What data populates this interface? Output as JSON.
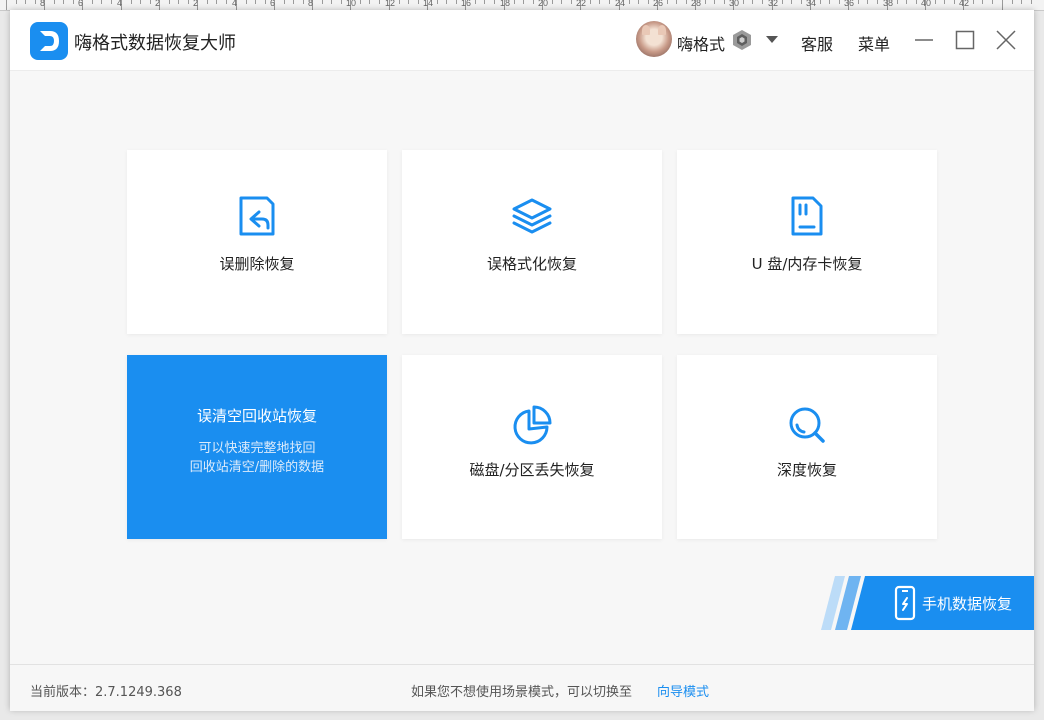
{
  "ruler": {
    "labels": [
      "8",
      "6",
      "4",
      "2",
      "2",
      "4",
      "6",
      "8",
      "10",
      "12",
      "14",
      "16",
      "18",
      "20",
      "22",
      "24",
      "26",
      "28",
      "30",
      "32",
      "34",
      "36",
      "38",
      "40",
      "42"
    ]
  },
  "app": {
    "title": "嗨格式数据恢复大师",
    "brand_color": "#1a8ef0"
  },
  "header": {
    "username": "嗨格式",
    "service_label": "客服",
    "menu_label": "菜单",
    "icons": {
      "avatar": "avatar-image",
      "vip": "vip-badge-icon",
      "dropdown": "caret-down-icon",
      "minimize": "minimize-icon",
      "maximize": "maximize-icon",
      "close": "close-icon"
    }
  },
  "cards": {
    "deleted": {
      "label": "误删除恢复",
      "icon": "file-restore-icon"
    },
    "formatted": {
      "label": "误格式化恢复",
      "icon": "layers-icon"
    },
    "usb": {
      "label": "U 盘/内存卡恢复",
      "icon": "sd-card-icon"
    },
    "recycle": {
      "label": "误清空回收站恢复",
      "desc_line1": "可以快速完整地找回",
      "desc_line2": "回收站清空/删除的数据"
    },
    "partition": {
      "label": "磁盘/分区丢失恢复",
      "icon": "pie-chart-icon"
    },
    "deep": {
      "label": "深度恢复",
      "icon": "search-icon"
    }
  },
  "mobile": {
    "label": "手机数据恢复",
    "icon": "phone-icon"
  },
  "footer": {
    "version": "当前版本：2.7.1249.368",
    "hint": "如果您不想使用场景模式，可以切换至",
    "guide_link": "向导模式",
    "link_color": "#1a8ef0"
  }
}
